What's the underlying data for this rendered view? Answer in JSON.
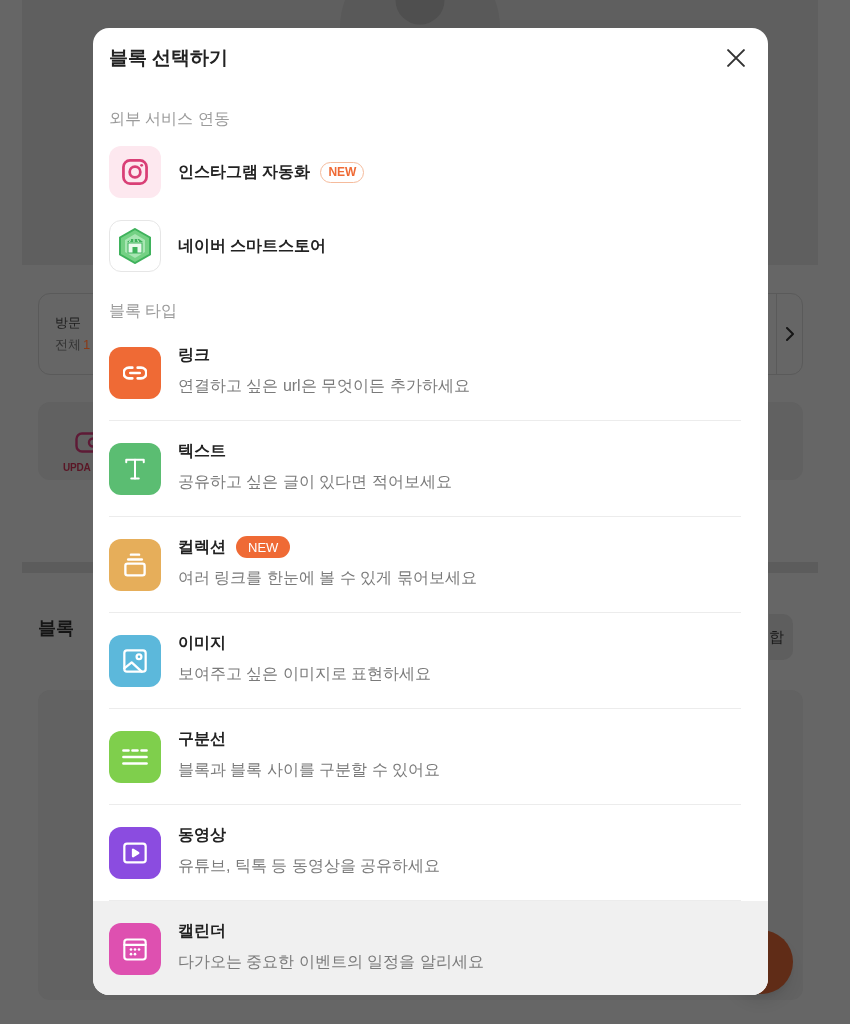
{
  "background": {
    "visitor_card": {
      "label": "방문",
      "total_label": "전체",
      "total_value": "1"
    },
    "update_card": {
      "logo_text": "UPDA"
    },
    "block_list": {
      "heading": "블록",
      "button": "합"
    }
  },
  "modal": {
    "title": "블록 선택하기",
    "sections": [
      {
        "kind": "integrations",
        "heading": "외부 서비스 연동",
        "items": [
          {
            "kind": "instagram",
            "title": "인스타그램 자동화",
            "badge": {
              "kind": "outline",
              "text": "NEW"
            }
          },
          {
            "kind": "store",
            "title": "네이버 스마트스토어"
          }
        ]
      },
      {
        "kind": "block_types",
        "heading": "블록 타입",
        "items": [
          {
            "kind": "link",
            "color": "#ef6a35",
            "title": "링크",
            "description": "연결하고 싶은 url은 무엇이든 추가하세요",
            "highlighted": false
          },
          {
            "kind": "text",
            "color": "#5bbd72",
            "title": "텍스트",
            "description": "공유하고 싶은 글이 있다면 적어보세요",
            "highlighted": false
          },
          {
            "kind": "collection",
            "color": "#e6ae5a",
            "title": "컬렉션",
            "badge": {
              "kind": "filled",
              "text": "NEW"
            },
            "description": "여러 링크를 한눈에 볼 수 있게 묶어보세요",
            "highlighted": false
          },
          {
            "kind": "image",
            "color": "#5cb8db",
            "title": "이미지",
            "description": "보여주고 싶은 이미지로 표현하세요",
            "highlighted": false
          },
          {
            "kind": "divider",
            "color": "#7fcf4c",
            "title": "구분선",
            "description": "블록과 블록 사이를 구분할 수 있어요",
            "highlighted": false
          },
          {
            "kind": "video",
            "color": "#8b4ce0",
            "title": "동영상",
            "description": "유튜브, 틱톡 등 동영상을 공유하세요",
            "highlighted": false
          },
          {
            "kind": "calendar",
            "color": "#de50b0",
            "title": "캘린더",
            "description": "다가오는 중요한 이벤트의 일정을 알리세요",
            "highlighted": true
          }
        ]
      }
    ]
  }
}
